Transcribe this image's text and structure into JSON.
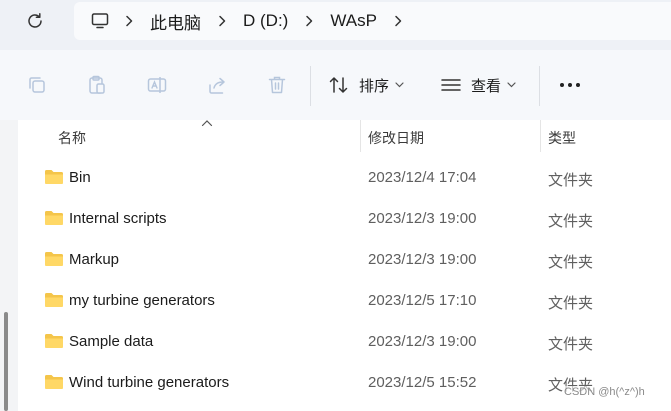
{
  "address_bar": {
    "crumbs": [
      "此电脑",
      "D (D:)",
      "WAsP"
    ]
  },
  "command_bar": {
    "sort_label": "排序",
    "view_label": "查看"
  },
  "list": {
    "columns": {
      "name": "名称",
      "modified": "修改日期",
      "type": "类型"
    },
    "rows": [
      {
        "name": "Bin",
        "modified": "2023/12/4 17:04",
        "type": "文件夹"
      },
      {
        "name": "Internal scripts",
        "modified": "2023/12/3 19:00",
        "type": "文件夹"
      },
      {
        "name": "Markup",
        "modified": "2023/12/3 19:00",
        "type": "文件夹"
      },
      {
        "name": "my turbine generators",
        "modified": "2023/12/5 17:10",
        "type": "文件夹"
      },
      {
        "name": "Sample data",
        "modified": "2023/12/3 19:00",
        "type": "文件夹"
      },
      {
        "name": "Wind turbine generators",
        "modified": "2023/12/5 15:52",
        "type": "文件夹"
      }
    ]
  },
  "watermark": "CSDN @h(^z^)h",
  "colors": {
    "folder": "#f4c54a",
    "icon_disabled": "#b6c6dc",
    "list_background": "#ffffff",
    "chrome_background": "#eef1f6"
  },
  "icons": [
    "refresh-icon",
    "computer-icon",
    "chevron-right-icon",
    "copy-icon",
    "paste-icon",
    "rename-icon",
    "share-icon",
    "delete-icon",
    "sort-icon",
    "view-icon",
    "more-icon",
    "folder-icon"
  ]
}
